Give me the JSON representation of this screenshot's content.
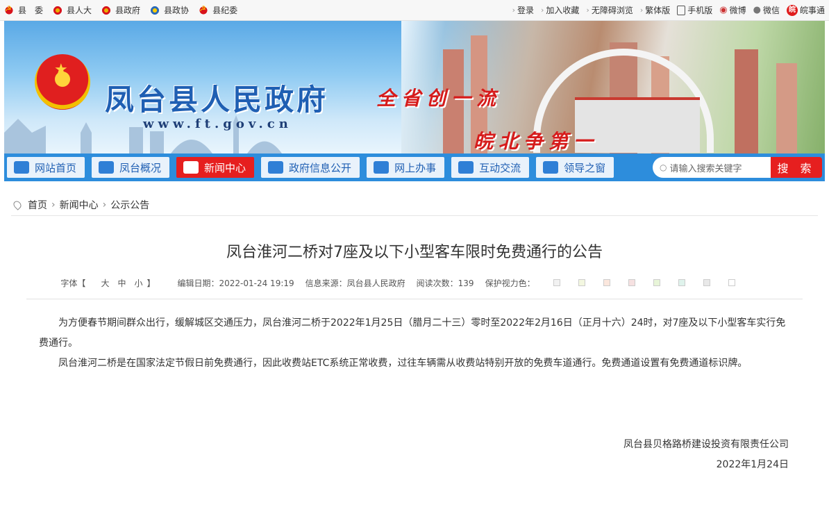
{
  "topbar": {
    "left_links": [
      {
        "label": "县　委",
        "icon": "party-icon-red"
      },
      {
        "label": "县人大",
        "icon": "national-emblem-icon"
      },
      {
        "label": "县政府",
        "icon": "national-emblem-icon"
      },
      {
        "label": "县政协",
        "icon": "cppcc-icon"
      },
      {
        "label": "县纪委",
        "icon": "party-icon-red"
      }
    ],
    "right_links": {
      "login": "登录",
      "favorite": "加入收藏",
      "accessibility": "无障碍浏览",
      "traditional": "繁体版",
      "mobile": "手机版",
      "weibo": "微博",
      "wechat": "微信",
      "wanshitong": "皖事通"
    }
  },
  "banner": {
    "site_name": "凤台县人民政府",
    "site_url": "www.ft.gov.cn",
    "slogan_1": "全省创一流",
    "slogan_2": "皖北争第一"
  },
  "nav": {
    "items": [
      {
        "label": "网站首页",
        "icon": "home-icon"
      },
      {
        "label": "凤台概况",
        "icon": "building-icon"
      },
      {
        "label": "新闻中心",
        "icon": "news-icon"
      },
      {
        "label": "政府信息公开",
        "icon": "info-icon"
      },
      {
        "label": "网上办事",
        "icon": "computer-icon"
      },
      {
        "label": "互动交流",
        "icon": "people-icon"
      },
      {
        "label": "领导之窗",
        "icon": "leader-icon"
      }
    ],
    "active_index": 2,
    "search_placeholder": "请输入搜索关键字",
    "search_button": "搜 索"
  },
  "breadcrumb": {
    "items": [
      "首页",
      "新闻中心",
      "公示公告"
    ]
  },
  "article": {
    "title": "凤台淮河二桥对7座及以下小型客车限时免费通行的公告",
    "meta": {
      "font_label": "字体【",
      "font_large": "大",
      "font_medium": "中",
      "font_small": "小",
      "font_close": "】",
      "date": "编辑日期：2022-01-24 19:19",
      "source": "信息来源：凤台县人民政府",
      "views": "阅读次数：139",
      "eye_color_label": "保护视力色："
    },
    "eye_colors": [
      "#f2f2f2",
      "#f3f7e0",
      "#fbe7dd",
      "#f6e1e1",
      "#e8f5d8",
      "#dff3ec",
      "#e9e9e9",
      "#ffffff"
    ],
    "paragraphs": [
      "为方便春节期间群众出行，缓解城区交通压力，凤台淮河二桥于2022年1月25日（腊月二十三）零时至2022年2月16日（正月十六）24时，对7座及以下小型客车实行免费通行。",
      "凤台淮河二桥是在国家法定节假日前免费通行，因此收费站ETC系统正常收费，过往车辆需从收费站特别开放的免费车道通行。免费通道设置有免费通道标识牌。"
    ],
    "signature_org": "凤台县贝格路桥建设投资有限责任公司",
    "signature_date": "2022年1月24日"
  }
}
